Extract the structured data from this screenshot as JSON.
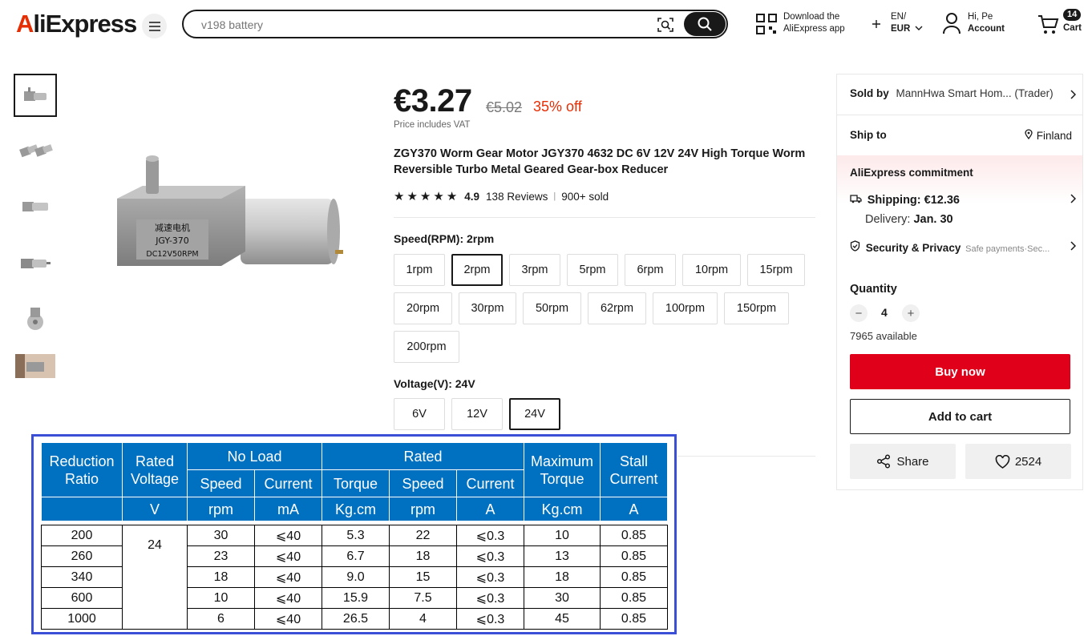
{
  "header": {
    "logo": "AliExpress",
    "search_placeholder": "v198 battery",
    "download_line1": "Download the",
    "download_line2": "AliExpress app",
    "language": "EN/",
    "currency": "EUR",
    "greeting": "Hi, Pe",
    "account": "Account",
    "cart_count": "14",
    "cart_label": "Cart"
  },
  "product": {
    "price": "€3.27",
    "original_price": "€5.02",
    "discount": "35% off",
    "vat_note": "Price includes VAT",
    "title": "ZGY370 Worm Gear Motor JGY370 4632 DC 6V 12V 24V High Torque Worm Reversible Turbo Metal Geared Gear-box Reducer",
    "rating": "4.9",
    "reviews": "138 Reviews",
    "sold": "900+ sold",
    "image_label_cn": "减速电机",
    "image_label_model": "JGY-370",
    "image_label_spec": "DC12V50RPM"
  },
  "speed": {
    "label": "Speed(RPM): 2rpm",
    "options": [
      "1rpm",
      "2rpm",
      "3rpm",
      "5rpm",
      "6rpm",
      "10rpm",
      "15rpm",
      "20rpm",
      "30rpm",
      "50rpm",
      "62rpm",
      "100rpm",
      "150rpm",
      "200rpm"
    ],
    "selected": "2rpm"
  },
  "voltage": {
    "label": "Voltage(V): 24V",
    "options": [
      "6V",
      "12V",
      "24V"
    ],
    "selected": "24V"
  },
  "side": {
    "sold_by_label": "Sold by",
    "seller": "MannHwa Smart Hom... (Trader)",
    "ship_to_label": "Ship to",
    "ship_to": "Finland",
    "commitment": "AliExpress commitment",
    "shipping": "Shipping: €12.36",
    "delivery_label": "Delivery:",
    "delivery": "Jan. 30",
    "security": "Security & Privacy",
    "security_sub": "Safe payments·Sec...",
    "quantity_label": "Quantity",
    "quantity": "4",
    "available": "7965 available",
    "buy_now": "Buy now",
    "add_to_cart": "Add to cart",
    "share": "Share",
    "wishlist_count": "2524"
  },
  "spec_table": {
    "headers": {
      "reduction_ratio": "Reduction Ratio",
      "rated_voltage": "Rated Voltage",
      "no_load": "No Load",
      "rated": "Rated",
      "maximum_torque": "Maximum Torque",
      "stall_current": "Stall Current",
      "speed": "Speed",
      "current": "Current",
      "torque": "Torque"
    },
    "units": [
      "V",
      "rpm",
      "mA",
      "Kg.cm",
      "rpm",
      "A",
      "Kg.cm",
      "A"
    ],
    "voltage": "24",
    "rows": [
      {
        "ratio": "200",
        "nl_speed": "30",
        "nl_current": "⩽40",
        "torque": "5.3",
        "speed": "22",
        "current": "⩽0.3",
        "max_torque": "10",
        "stall": "0.85"
      },
      {
        "ratio": "260",
        "nl_speed": "23",
        "nl_current": "⩽40",
        "torque": "6.7",
        "speed": "18",
        "current": "⩽0.3",
        "max_torque": "13",
        "stall": "0.85"
      },
      {
        "ratio": "340",
        "nl_speed": "18",
        "nl_current": "⩽40",
        "torque": "9.0",
        "speed": "15",
        "current": "⩽0.3",
        "max_torque": "18",
        "stall": "0.85"
      },
      {
        "ratio": "600",
        "nl_speed": "10",
        "nl_current": "⩽40",
        "torque": "15.9",
        "speed": "7.5",
        "current": "⩽0.3",
        "max_torque": "30",
        "stall": "0.85"
      },
      {
        "ratio": "1000",
        "nl_speed": "6",
        "nl_current": "⩽40",
        "torque": "26.5",
        "speed": "4",
        "current": "⩽0.3",
        "max_torque": "45",
        "stall": "0.85"
      }
    ]
  }
}
